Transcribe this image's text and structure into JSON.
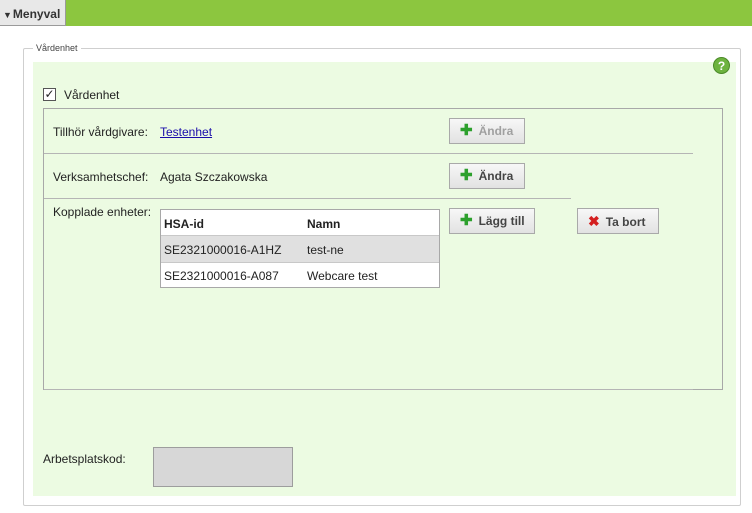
{
  "menu": {
    "tab_label": "Menyval"
  },
  "fieldset": {
    "legend": "Vårdenhet"
  },
  "help": {
    "label": "?"
  },
  "vardenhet_checkbox": {
    "label": "Vårdenhet",
    "checked": true,
    "mark": "✓"
  },
  "vardgivare": {
    "label": "Tillhör vårdgivare:",
    "value": "Testenhet",
    "button_label": "Ändra"
  },
  "verksamhetschef": {
    "label": "Verksamhetschef:",
    "value": "Agata Szczakowska",
    "button_label": "Ändra"
  },
  "kopplade": {
    "label": "Kopplade enheter:",
    "columns": [
      "HSA-id",
      "Namn"
    ],
    "rows": [
      {
        "hsa_id": "SE2321000016-A1HZ",
        "namn": "test-ne",
        "selected": true
      },
      {
        "hsa_id": "SE2321000016-A087",
        "namn": "Webcare test",
        "selected": false
      }
    ],
    "add_button_label": "Lägg till",
    "remove_button_label": "Ta bort"
  },
  "arbetsplatskod": {
    "label": "Arbetsplatskod:",
    "value": ""
  },
  "icons": {
    "plus": "plus-icon",
    "remove": "x-icon",
    "menu": "triangle-down-icon"
  },
  "colors": {
    "topbar": "#8cc63f",
    "panel": "#ecfbe2",
    "plus": "#2da02d",
    "remove": "#d41f1f",
    "help": "#6db33f"
  }
}
